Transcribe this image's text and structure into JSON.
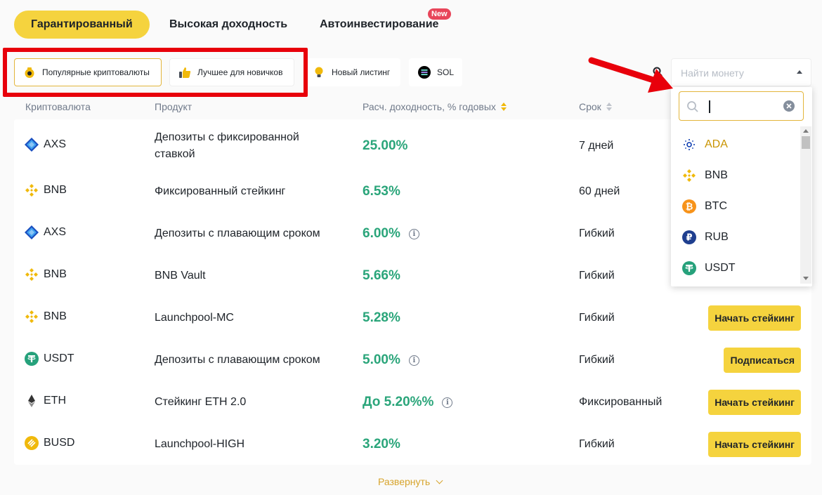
{
  "top_tabs": [
    "Гарантированный",
    "Высокая доходность",
    "Автоинвестирование"
  ],
  "new_badge": "New",
  "chips": [
    "Популярные криптовалюты",
    "Лучшее для новичков",
    "Новый листинг",
    "SOL"
  ],
  "search": {
    "placeholder": "Найти монету"
  },
  "columns": [
    "Криптовалюта",
    "Продукт",
    "Расч. доходность, % годовых",
    "Срок"
  ],
  "rows": [
    {
      "coin": "AXS",
      "icon": "axs-icon",
      "product_line1": "Депозиты с фиксированной",
      "product_line2": "ставкой",
      "apy": "25.00%",
      "term": "7 дней",
      "action": ""
    },
    {
      "coin": "BNB",
      "icon": "bnb-icon",
      "product_line1": "Фиксированный стейкинг",
      "product_line2": "",
      "apy": "6.53%",
      "term": "60 дней",
      "action": ""
    },
    {
      "coin": "AXS",
      "icon": "axs-icon",
      "product_line1": "Депозиты с плавающим сроком",
      "product_line2": "",
      "apy": "6.00%",
      "term": "Гибкий",
      "action": ""
    },
    {
      "coin": "BNB",
      "icon": "bnb-icon",
      "product_line1": "BNB Vault",
      "product_line2": "",
      "apy": "5.66%",
      "term": "Гибкий",
      "action": ""
    },
    {
      "coin": "BNB",
      "icon": "bnb-icon",
      "product_line1": "Launchpool-MC",
      "product_line2": "",
      "apy": "5.28%",
      "term": "Гибкий",
      "action": "Начать стейкинг"
    },
    {
      "coin": "USDT",
      "icon": "usdt-icon",
      "product_line1": "Депозиты с плавающим сроком",
      "product_line2": "",
      "apy": "5.00%",
      "term": "Гибкий",
      "action": "Подписаться"
    },
    {
      "coin": "ETH",
      "icon": "eth-icon",
      "product_line1": "Стейкинг ETH 2.0",
      "product_line2": "",
      "apy": "До 5.20%%",
      "term": "Фиксированный",
      "action": "Начать стейкинг"
    },
    {
      "coin": "BUSD",
      "icon": "busd-icon",
      "product_line1": "Launchpool-HIGH",
      "product_line2": "",
      "apy": "3.20%",
      "term": "Гибкий",
      "action": "Начать стейкинг"
    }
  ],
  "expand_label": "Развернуть",
  "dropdown": {
    "items": [
      {
        "label": "ADA",
        "icon": "ada-icon"
      },
      {
        "label": "BNB",
        "icon": "bnb-icon"
      },
      {
        "label": "BTC",
        "icon": "btc-icon"
      },
      {
        "label": "RUB",
        "icon": "rub-icon"
      },
      {
        "label": "USDT",
        "icon": "usdt-icon"
      }
    ]
  },
  "colors": {
    "accent": "#f5d33e",
    "apy_green": "#2aa57a",
    "annotation_red": "#e8000b"
  }
}
